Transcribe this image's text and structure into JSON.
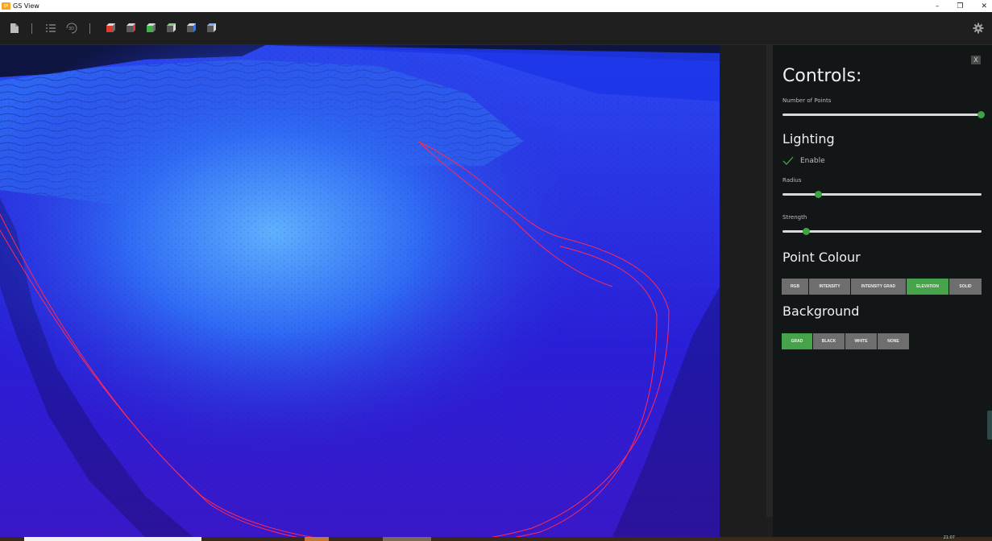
{
  "window": {
    "title": "GS View",
    "controls": {
      "minimize": "–",
      "restore": "❐",
      "close": "✕"
    }
  },
  "toolbar": {
    "icons": [
      "file-icon",
      "list-icon",
      "3d-icon",
      "cube-front-icon",
      "cube-left-icon",
      "cube-right-icon",
      "cube-top-icon",
      "cube-back-icon",
      "cube-bottom-icon",
      "settings-icon"
    ],
    "three_d_label": "3D"
  },
  "panel": {
    "close_label": "X",
    "title": "Controls:",
    "number_of_points": {
      "label": "Number of Points",
      "value": 1.0
    },
    "lighting": {
      "title": "Lighting",
      "enable_label": "Enable",
      "enabled": true,
      "radius": {
        "label": "Radius",
        "value": 0.18
      },
      "strength": {
        "label": "Strength",
        "value": 0.12
      }
    },
    "point_colour": {
      "title": "Point Colour",
      "options": [
        "RGB",
        "INTENSITY",
        "INTENSITY GRAD",
        "ELEVATION",
        "SOLID"
      ],
      "selected": "ELEVATION"
    },
    "background": {
      "title": "Background",
      "options": [
        "GRAD",
        "BLACK",
        "WHITE",
        "NONE"
      ],
      "selected": "GRAD"
    }
  },
  "taskbar": {
    "clock": "21:07"
  },
  "colors": {
    "accent_green": "#46a34a",
    "button_gray": "#6e6e6e",
    "panel_bg": "#121616",
    "terrain_blue": "#1f2fe0",
    "track_red": "#ff2050"
  }
}
